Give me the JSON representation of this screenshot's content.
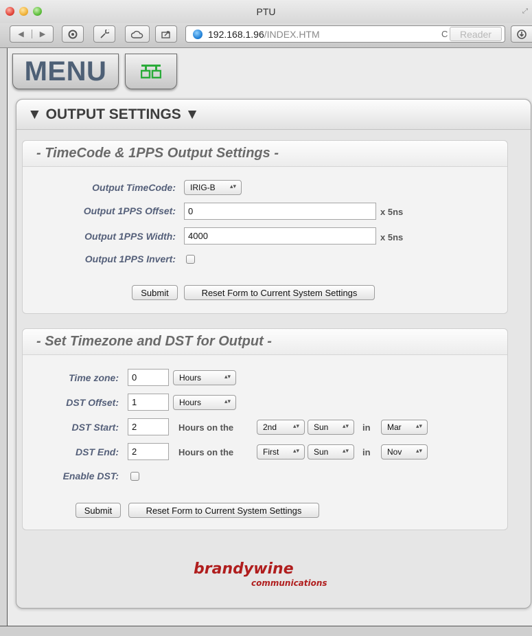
{
  "window": {
    "title": "PTU"
  },
  "toolbar": {
    "url_host": "192.168.1.96",
    "url_path": "/INDEX.HTM",
    "reader_label": "Reader",
    "reload_glyph": "C"
  },
  "nav": {
    "menu_label": "MENU",
    "network_icon": "network-icon"
  },
  "main": {
    "title": "▼ OUTPUT SETTINGS ▼"
  },
  "timecode_section": {
    "title": "- TimeCode & 1PPS Output Settings -",
    "output_timecode_label": "Output TimeCode:",
    "output_timecode_value": "IRIG-B",
    "pps_offset_label": "Output 1PPS Offset:",
    "pps_offset_value": "0",
    "pps_offset_unit": "x 5ns",
    "pps_width_label": "Output 1PPS Width:",
    "pps_width_value": "4000",
    "pps_width_unit": "x 5ns",
    "pps_invert_label": "Output 1PPS Invert:",
    "submit_label": "Submit",
    "reset_label": "Reset Form to Current System Settings"
  },
  "timezone_section": {
    "title": "- Set Timezone and DST for Output -",
    "time_zone_label": "Time zone:",
    "time_zone_value": "0",
    "time_zone_unit": "Hours",
    "dst_offset_label": "DST Offset:",
    "dst_offset_value": "1",
    "dst_offset_unit": "Hours",
    "dst_start_label": "DST Start:",
    "dst_start_hours": "2",
    "dst_start_week": "2nd",
    "dst_start_day": "Sun",
    "dst_start_month": "Mar",
    "dst_end_label": "DST End:",
    "dst_end_hours": "2",
    "dst_end_week": "First",
    "dst_end_day": "Sun",
    "dst_end_month": "Nov",
    "hours_on_the": "Hours on the",
    "in_label": "in",
    "enable_dst_label": "Enable DST:",
    "submit_label": "Submit",
    "reset_label": "Reset Form to Current System Settings"
  },
  "footer": {
    "logo_main": "brandywine",
    "logo_sub": "communications"
  },
  "colors": {
    "label_blue": "#55607a",
    "logo_red": "#b01e1e",
    "network_green": "#2bab3a"
  }
}
